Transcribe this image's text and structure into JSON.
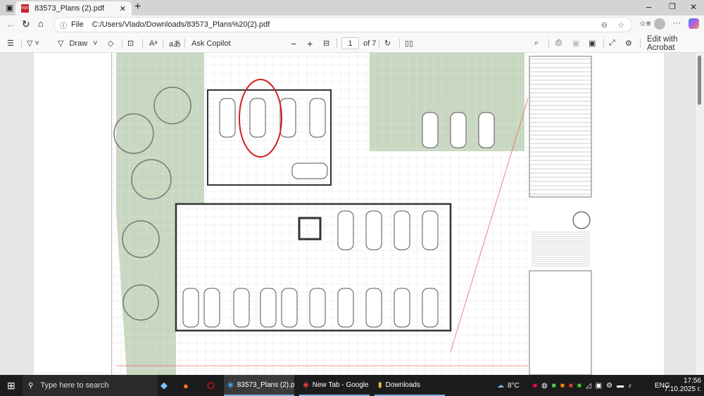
{
  "browser": {
    "tab_title": "83573_Plans (2).pdf",
    "address_label": "File",
    "url": "C:/Users/Vlado/Downloads/83573_Plans%20(2).pdf"
  },
  "toolbar": {
    "draw_label": "Draw",
    "ask_copilot": "Ask Copilot",
    "page_current": "1",
    "page_total": "of 7",
    "edit_acrobat": "Edit with Acrobat"
  },
  "taskbar": {
    "search_placeholder": "Type here to search",
    "apps": [
      {
        "label": "83573_Plans (2).pdf..."
      },
      {
        "label": "New Tab - Google ..."
      },
      {
        "label": "Downloads"
      }
    ],
    "weather": "8°C",
    "language": "ENG",
    "time": "17:56",
    "date": "7.10.2025 г."
  },
  "colors": {
    "annotation": "#d42020",
    "landscape": "#c8d7c0",
    "taskbar": "#1c1c1c"
  }
}
